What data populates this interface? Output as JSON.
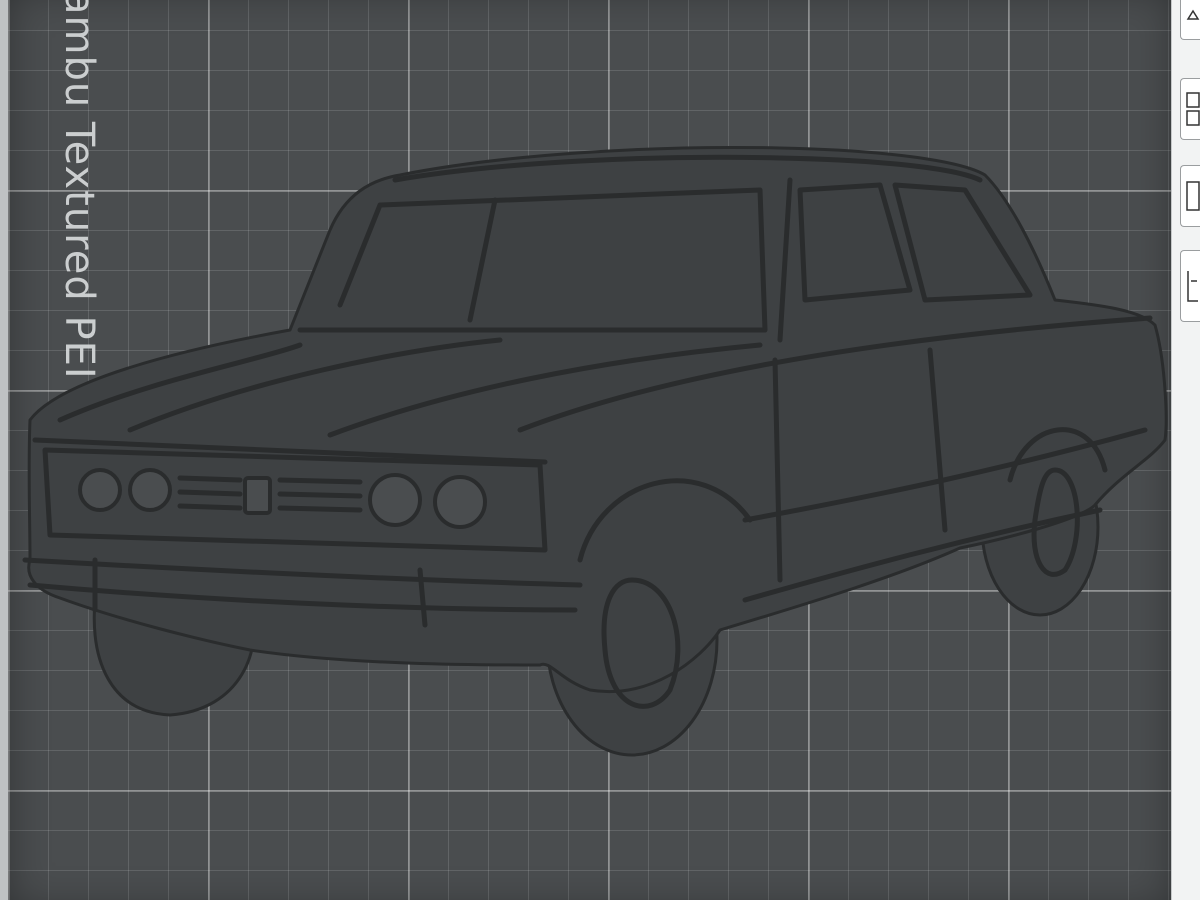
{
  "plate": {
    "label": "ambu Textured PEI Pl",
    "color": "#4a4d4f",
    "grid_color": "#ffffff"
  },
  "model": {
    "name": "car-silhouette",
    "color": "#3e4143",
    "outline_color": "#2a2c2d"
  },
  "toolbar": {
    "buttons": [
      {
        "icon": "auto-orient-icon"
      },
      {
        "icon": "arrange-icon"
      },
      {
        "icon": "layout-icon"
      },
      {
        "icon": "split-icon"
      }
    ]
  }
}
